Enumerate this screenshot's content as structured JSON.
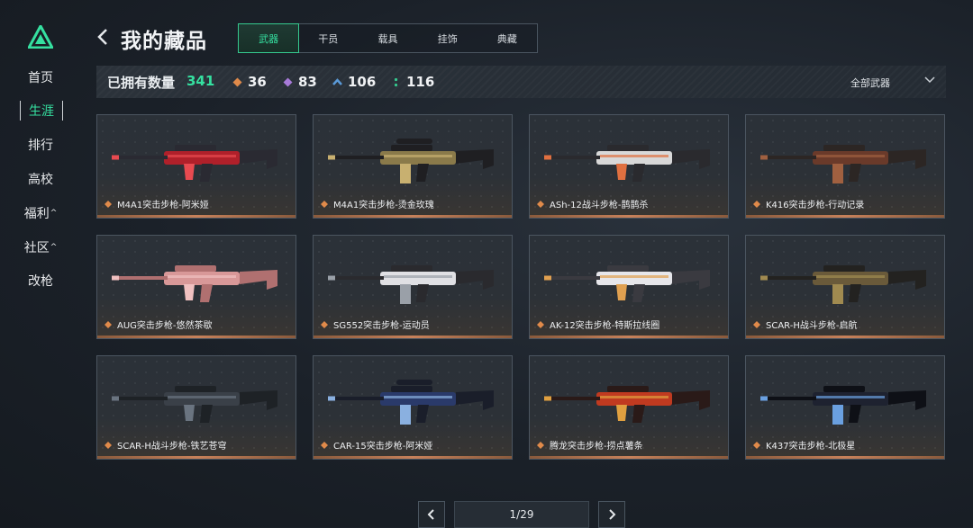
{
  "sidebar": {
    "items": [
      {
        "label": "首页",
        "active": false,
        "caret": ""
      },
      {
        "label": "生涯",
        "active": true,
        "caret": ""
      },
      {
        "label": "排行",
        "active": false,
        "caret": ""
      },
      {
        "label": "高校",
        "active": false,
        "caret": ""
      },
      {
        "label": "福利",
        "active": false,
        "caret": "^"
      },
      {
        "label": "社区",
        "active": false,
        "caret": "^"
      },
      {
        "label": "改枪",
        "active": false,
        "caret": ""
      }
    ]
  },
  "header": {
    "title": "我的藏品",
    "tabs": [
      "武器",
      "干员",
      "载具",
      "挂饰",
      "典藏"
    ],
    "active_tab": "武器"
  },
  "stats": {
    "label": "已拥有数量",
    "total": "341",
    "rarities": [
      {
        "icon": "orange-diamond-icon",
        "value": "36",
        "color": "#e08a4a"
      },
      {
        "icon": "purple-diamond-icon",
        "value": "83",
        "color": "#a77ad8"
      },
      {
        "icon": "blue-chevron-icon",
        "value": "106",
        "color": "#5a9ad8"
      },
      {
        "icon": "green-dots-icon",
        "value": "116",
        "color": "#35c98f"
      }
    ],
    "filter": "全部武器"
  },
  "items": [
    {
      "name": "M4A1突击步枪-阿米娅",
      "colors": [
        "#b0202a",
        "#2a2a32",
        "#e84a50"
      ]
    },
    {
      "name": "M4A1突击步枪-烫金玫瑰",
      "colors": [
        "#8a7a4a",
        "#1f1f22",
        "#c8b070"
      ]
    },
    {
      "name": "ASh-12战斗步枪-鹊鹊杀",
      "colors": [
        "#d8d8d8",
        "#2a2a2e",
        "#e07040"
      ]
    },
    {
      "name": "K416突击步枪-行动记录",
      "colors": [
        "#6a3a2a",
        "#2c2624",
        "#a06040"
      ]
    },
    {
      "name": "AUG突击步枪-悠然茶歇",
      "colors": [
        "#d89898",
        "#b07070",
        "#f0c0c0"
      ]
    },
    {
      "name": "SG552突击步枪-运动员",
      "colors": [
        "#e0e0e4",
        "#2a2a2e",
        "#9aa0a8"
      ]
    },
    {
      "name": "AK-12突击步枪-特斯拉线圈",
      "colors": [
        "#e6e6ea",
        "#3a3a40",
        "#e0a050"
      ]
    },
    {
      "name": "SCAR-H战斗步枪-启航",
      "colors": [
        "#6a5a3a",
        "#232220",
        "#a08a50"
      ]
    },
    {
      "name": "SCAR-H战斗步枪-铁艺苍穹",
      "colors": [
        "#3a4048",
        "#1e2226",
        "#6a7480"
      ]
    },
    {
      "name": "CAR-15突击步枪-阿米娅",
      "colors": [
        "#2a3a6a",
        "#1a1e2a",
        "#8ab0e0"
      ]
    },
    {
      "name": "腾龙突击步枪-捞点薯条",
      "colors": [
        "#c03a20",
        "#2a1a18",
        "#e0a040"
      ]
    },
    {
      "name": "K437突击步枪-北极星",
      "colors": [
        "#1e2230",
        "#0e1016",
        "#6aa0e0"
      ]
    }
  ],
  "pagination": {
    "page": "1/29"
  }
}
